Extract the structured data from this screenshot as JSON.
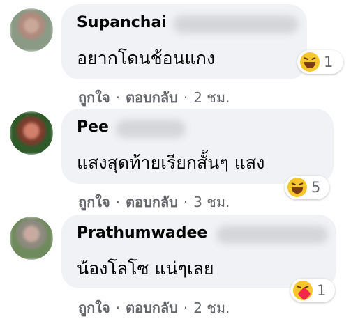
{
  "comments": [
    {
      "author": "Supanchai",
      "text": "อยากโดนช้อนแกง",
      "reaction": {
        "type": "haha",
        "count": "1"
      },
      "actions": {
        "like": "ถูกใจ",
        "reply": "ตอบกลับ",
        "time": "2 ชม."
      }
    },
    {
      "author": "Pee",
      "text": "แสงสุดท้ายเรียกสั้นๆ แสง",
      "reaction": {
        "type": "haha",
        "count": "5"
      },
      "actions": {
        "like": "ถูกใจ",
        "reply": "ตอบกลับ",
        "time": "3 ชม."
      }
    },
    {
      "author": "Prathumwadee",
      "text": "น้องโลโซ แน่ๆเลย",
      "reaction": {
        "type": "care",
        "count": "1"
      },
      "actions": {
        "like": "ถูกใจ",
        "reply": "ตอบกลับ",
        "time": "2 ชม."
      }
    }
  ],
  "colors": {
    "bubble": "#f0f2f5",
    "secondary_text": "#65676b",
    "reaction_yellow": "#f7c52c"
  }
}
